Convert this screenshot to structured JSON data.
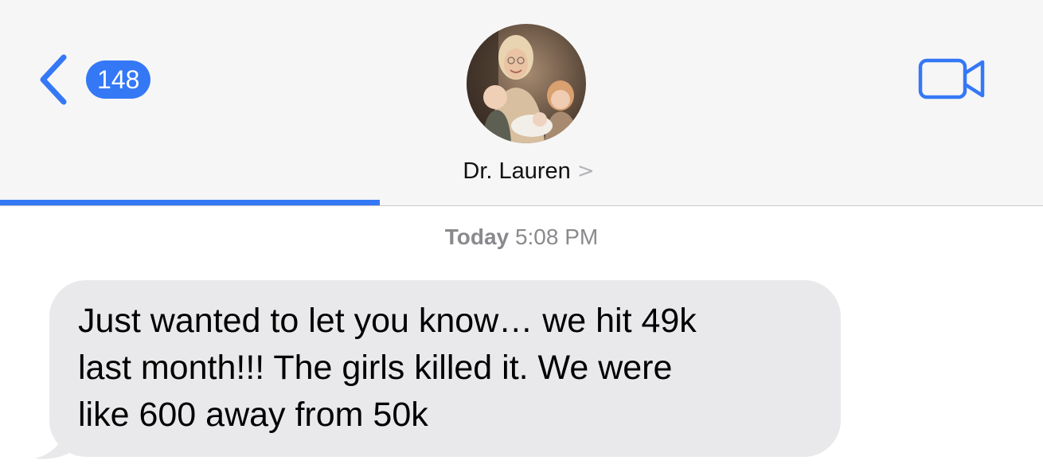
{
  "nav": {
    "unread_count": "148",
    "contact_name": "Dr. Lauren",
    "contact_chevron": ">",
    "back_icon": "chevron-left-icon",
    "video_icon": "video-camera-icon",
    "progress": 0.364
  },
  "colors": {
    "accent": "#3478f6",
    "header_bg": "#f6f6f6",
    "bubble_bg": "#e9e9eb",
    "timestamp": "#8a8a8e"
  },
  "conversation": {
    "timestamp_day": "Today",
    "timestamp_time": "5:08 PM",
    "messages": [
      {
        "direction": "incoming",
        "text": "Just wanted to let you know… we hit 49k\nlast month!!! The girls killed it. We were\nlike 600 away from 50k"
      }
    ]
  }
}
